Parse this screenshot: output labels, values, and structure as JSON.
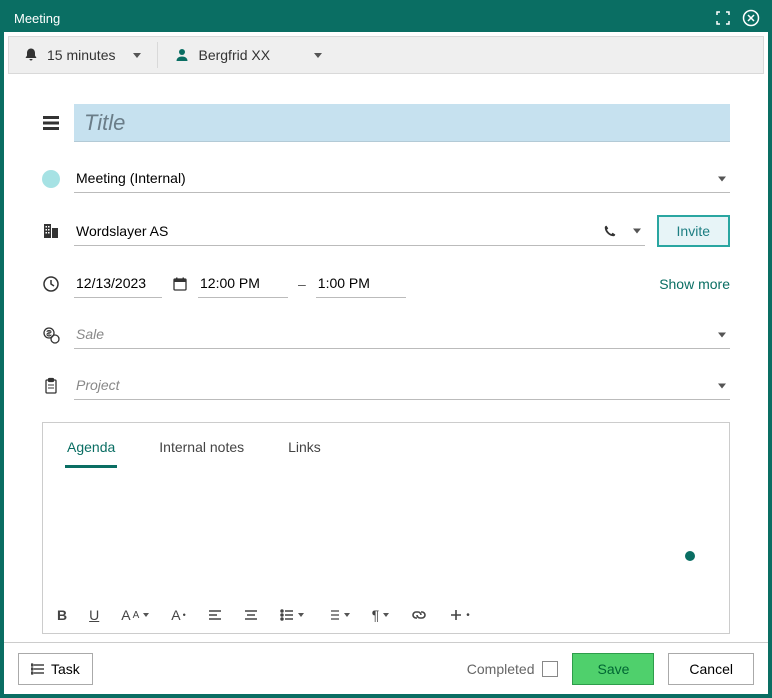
{
  "titlebar": {
    "title": "Meeting"
  },
  "toolbar": {
    "reminder_label": "15 minutes",
    "user_label": "Bergfrid XX"
  },
  "form": {
    "title_placeholder": "Title",
    "type_value": "Meeting (Internal)",
    "company_value": "Wordslayer AS",
    "invite_label": "Invite",
    "date_value": "12/13/2023",
    "start_time": "12:00 PM",
    "end_time": "1:00 PM",
    "show_more_label": "Show more",
    "sale_placeholder": "Sale",
    "project_placeholder": "Project"
  },
  "tabs": {
    "agenda": "Agenda",
    "internal_notes": "Internal notes",
    "links": "Links"
  },
  "footer": {
    "task_label": "Task",
    "completed_label": "Completed",
    "save_label": "Save",
    "cancel_label": "Cancel"
  }
}
